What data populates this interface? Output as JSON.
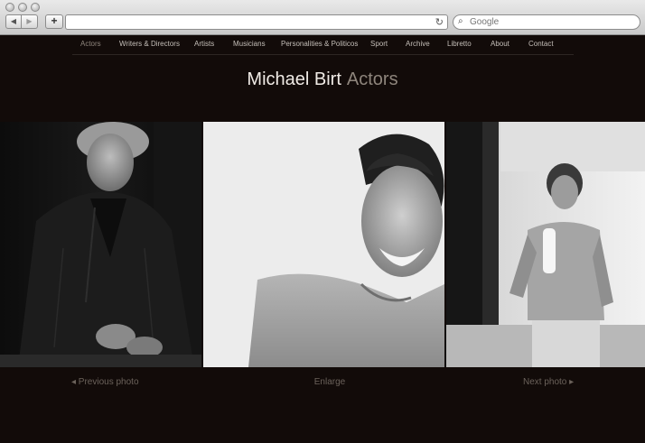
{
  "browser": {
    "back_glyph": "◀",
    "forward_glyph": "▶",
    "add_glyph": "+",
    "reload_glyph": "↻",
    "search_glyph": "⌕",
    "search_placeholder": "Google"
  },
  "nav": {
    "items": [
      {
        "label": "Actors",
        "active": true
      },
      {
        "label": "Writers & Directors"
      },
      {
        "label": "Artists"
      },
      {
        "label": "Musicians"
      },
      {
        "label": "Personalities & Politicos"
      },
      {
        "label": "Sport"
      },
      {
        "label": "Archive"
      },
      {
        "label": "Libretto"
      },
      {
        "label": "About"
      },
      {
        "label": "Contact"
      }
    ]
  },
  "header": {
    "name": "Michael Birt",
    "section": "Actors"
  },
  "photo_nav": {
    "prev": "◂ Previous photo",
    "enlarge": "Enlarge",
    "next": "Next photo ▸"
  },
  "colors": {
    "background": "#120b09",
    "nav_text": "#c5bfb9",
    "nav_active": "#8e857c",
    "title_name": "#f0ebe6",
    "title_section": "#8e857c",
    "photo_nav_text": "#6b625b"
  }
}
